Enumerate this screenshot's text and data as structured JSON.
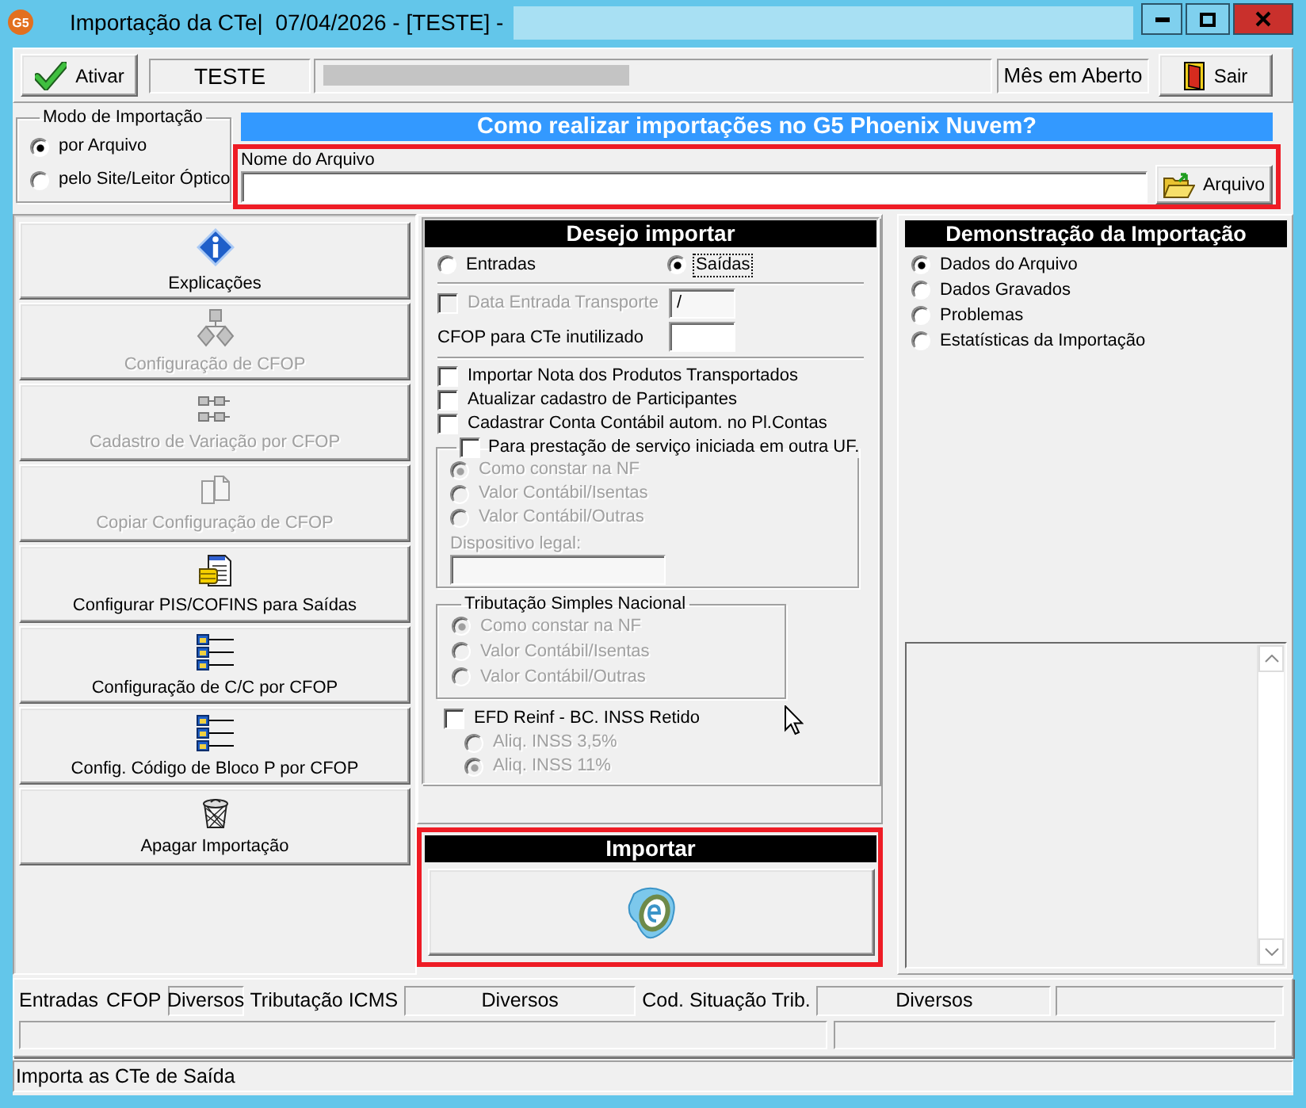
{
  "window": {
    "app_badge": "G5",
    "title": "Importação da CTe|  07/04/2026 - [TESTE] -"
  },
  "toolbar": {
    "activate_button": "Ativar",
    "company_code": "TESTE",
    "period_status": "Mês em Aberto",
    "exit_button": "Sair"
  },
  "import_mode": {
    "title": "Modo de Importação",
    "options": [
      {
        "label": "por Arquivo",
        "selected": true
      },
      {
        "label": "pelo Site/Leitor Óptico",
        "selected": false
      }
    ]
  },
  "help_banner": "Como realizar importações no G5 Phoenix Nuvem?",
  "file_section": {
    "highlighted": true,
    "label": "Nome do Arquivo",
    "button": "Arquivo"
  },
  "actions": [
    {
      "label": "Explicações",
      "disabled": false
    },
    {
      "label": "Configuração de CFOP",
      "disabled": true
    },
    {
      "label": "Cadastro de Variação por CFOP",
      "disabled": true
    },
    {
      "label": "Copiar Configuração de CFOP",
      "disabled": true
    },
    {
      "label": "Configurar PIS/COFINS para Saídas",
      "disabled": false
    },
    {
      "label": "Configuração de C/C por CFOP",
      "disabled": false
    },
    {
      "label": "Config. Código de Bloco P por CFOP",
      "disabled": false
    },
    {
      "label": "Apagar Importação",
      "disabled": false
    }
  ],
  "import_options": {
    "title": "Desejo importar",
    "direction": [
      {
        "label": "Entradas",
        "selected": false,
        "focused": false
      },
      {
        "label": "Saídas",
        "selected": true,
        "focused": true
      }
    ],
    "entry_date": {
      "label": "Data Entrada Transporte",
      "checked": false,
      "disabled": true,
      "value": "/"
    },
    "void_cfop_label": "CFOP para CTe inutilizado",
    "checks": [
      {
        "label": "Importar Nota dos Produtos Transportados",
        "checked": false
      },
      {
        "label": "Atualizar cadastro de Participantes",
        "checked": false
      },
      {
        "label": "Cadastrar Conta Contábil autom. no Pl.Contas",
        "checked": false
      }
    ],
    "other_uf": {
      "label": "Para prestação de serviço iniciada em outra UF.",
      "checked": false,
      "options_disabled": true,
      "options": [
        {
          "label": "Como constar na NF",
          "selected": true
        },
        {
          "label": "Valor Contábil/Isentas",
          "selected": false
        },
        {
          "label": "Valor Contábil/Outras",
          "selected": false
        }
      ],
      "legal_label": "Dispositivo legal:"
    },
    "simples": {
      "title": "Tributação Simples Nacional",
      "options_disabled": true,
      "options": [
        {
          "label": "Como constar na NF",
          "selected": true
        },
        {
          "label": "Valor Contábil/Isentas",
          "selected": false
        },
        {
          "label": "Valor Contábil/Outras",
          "selected": false
        }
      ]
    },
    "reinf": {
      "label": "EFD Reinf - BC. INSS Retido",
      "checked": false,
      "options_disabled": true,
      "options": [
        {
          "label": "Aliq. INSS 3,5%",
          "selected": false
        },
        {
          "label": "Aliq. INSS 11%",
          "selected": true
        }
      ]
    }
  },
  "import_panel": {
    "title": "Importar",
    "highlighted": true
  },
  "demo": {
    "title": "Demonstração da Importação",
    "options": [
      {
        "label": "Dados do Arquivo",
        "selected": true
      },
      {
        "label": "Dados Gravados",
        "selected": false
      },
      {
        "label": "Problemas",
        "selected": false
      },
      {
        "label": "Estatísticas da Importação",
        "selected": false
      }
    ]
  },
  "summary": {
    "items": [
      {
        "kind": "label",
        "text": "Entradas"
      },
      {
        "kind": "label",
        "text": "CFOP"
      },
      {
        "kind": "value",
        "text": "Diversos"
      },
      {
        "kind": "label",
        "text": "Tributação ICMS"
      },
      {
        "kind": "value",
        "text": "Diversos"
      },
      {
        "kind": "label",
        "text": "Cod. Situação Trib."
      },
      {
        "kind": "value",
        "text": "Diversos"
      },
      {
        "kind": "value"
      }
    ]
  },
  "status_bar": "Importa as CTe de Saída"
}
